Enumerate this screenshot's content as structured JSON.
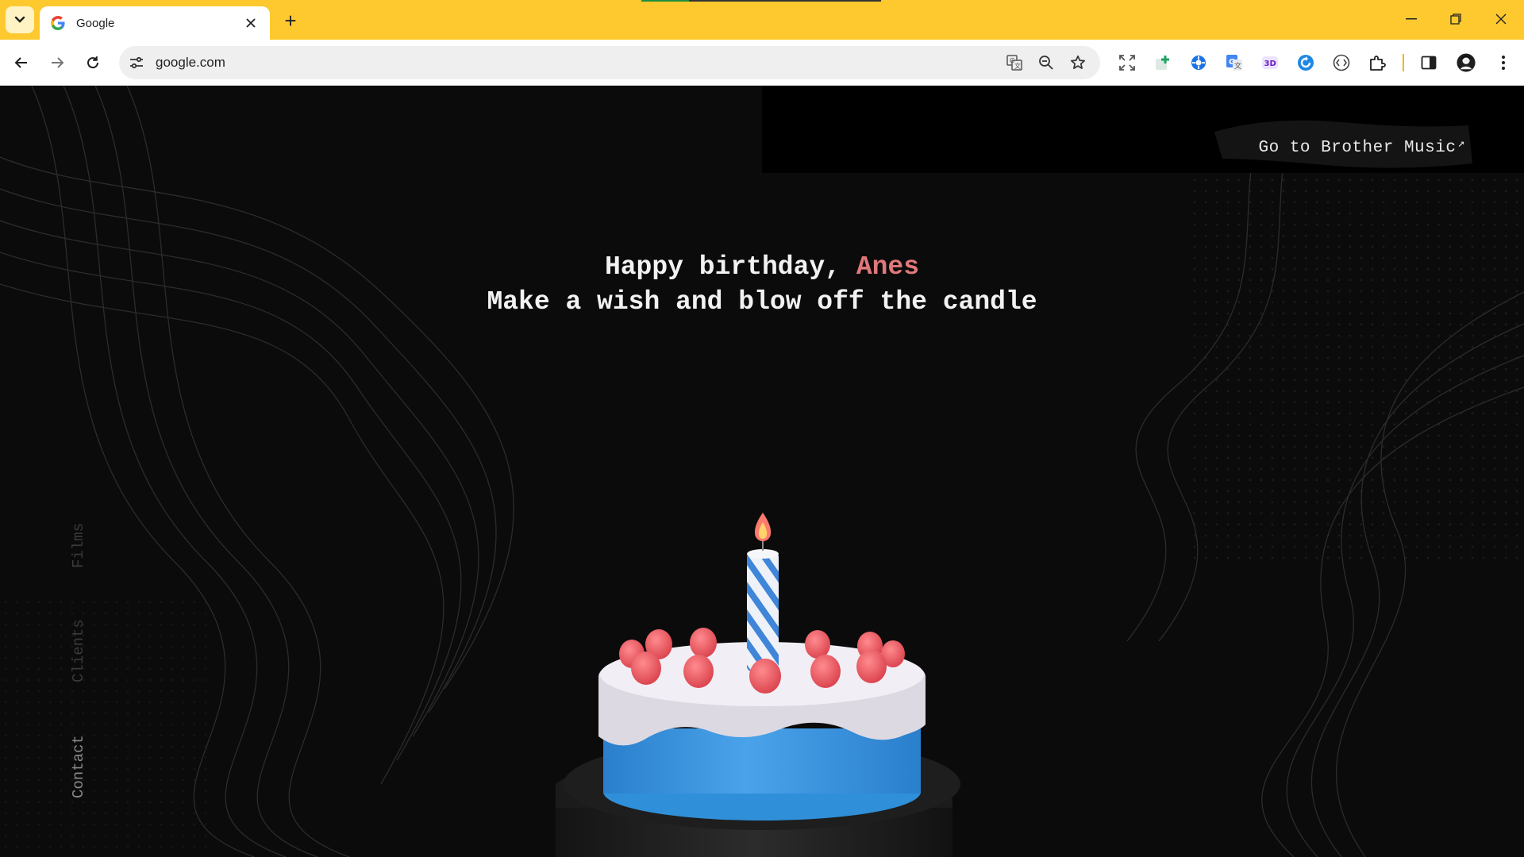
{
  "browser": {
    "tab_title": "Google",
    "new_tab_label": "+",
    "url": "google.com",
    "icons": {
      "tab_search": "chevron-down-icon",
      "back": "back-arrow-icon",
      "forward": "forward-arrow-icon",
      "reload": "reload-icon",
      "site_info": "tune-icon",
      "translate": "translate-icon",
      "zoom": "zoom-out-icon",
      "bookmark": "star-icon",
      "side_panel": "side-panel-icon",
      "profile": "avatar",
      "menu": "kebab-menu-icon"
    },
    "extensions": [
      "fullscreen-icon",
      "plus-extension-icon",
      "gear-extension-icon",
      "google-translate-icon",
      "3d-extension-icon",
      "refresh-extension-icon",
      "code-extension-icon",
      "puzzle-icon"
    ]
  },
  "page": {
    "external_link": "Go to Brother Music",
    "external_link_arrow": "↗",
    "greeting": "Happy birthday,",
    "name": "Anes",
    "instruction": "Make a wish and blow off the candle",
    "side_nav": [
      "Films",
      "Clients",
      "Contact"
    ]
  },
  "colors": {
    "chrome_bar": "#fdc92f",
    "background": "#0b0b0b",
    "name_accent": "#e0787a",
    "cake_frosting": "#2f8fd8",
    "cake_icing": "#e9e6ee",
    "berries": "#e5525b"
  }
}
